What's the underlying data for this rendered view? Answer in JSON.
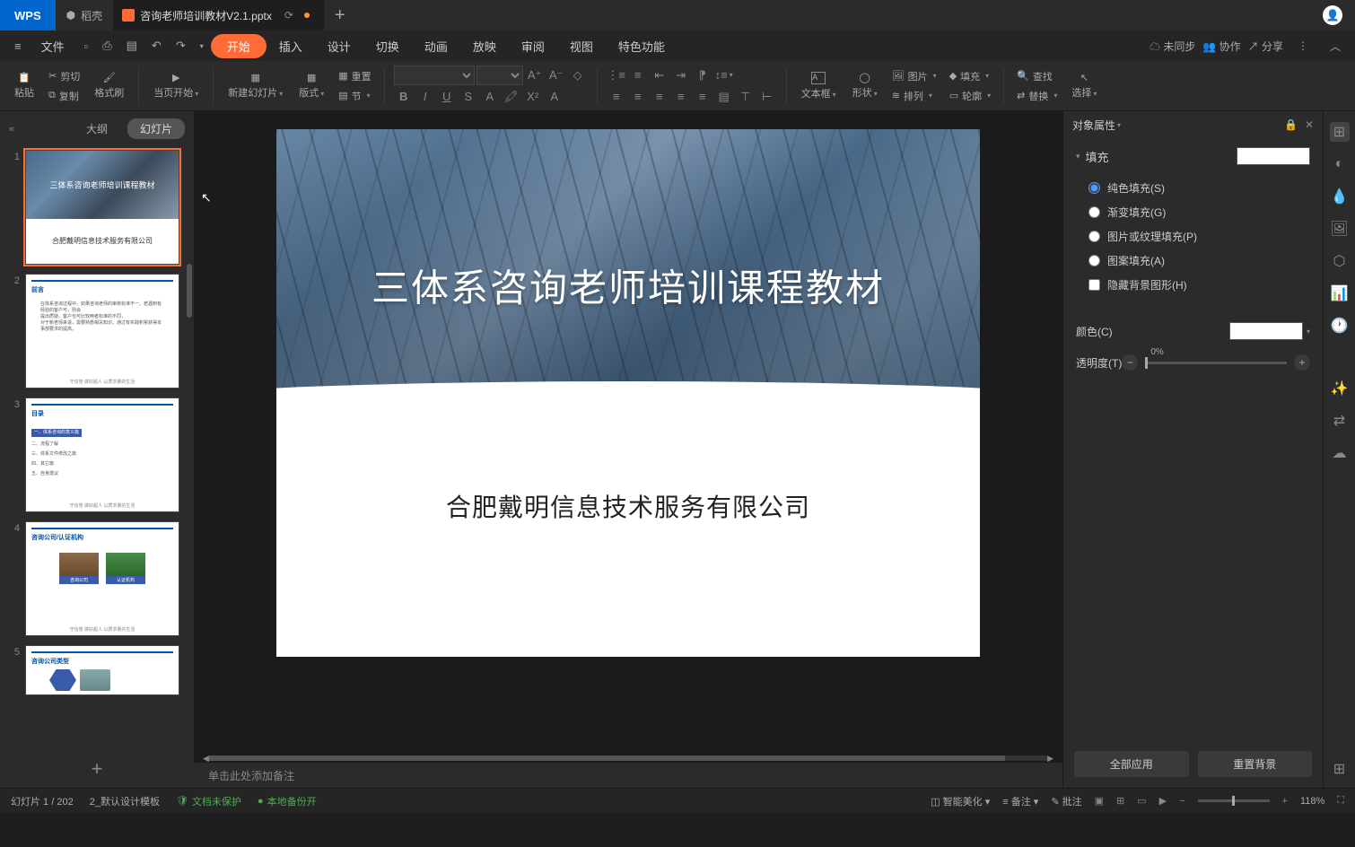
{
  "titlebar": {
    "logo": "WPS",
    "docke": "稻壳",
    "filename": "咨询老师培训教材V2.1.pptx",
    "add": "+"
  },
  "menubar": {
    "file": "文件",
    "items": [
      "开始",
      "插入",
      "设计",
      "切换",
      "动画",
      "放映",
      "审阅",
      "视图",
      "特色功能"
    ],
    "sync": "未同步",
    "collab": "协作",
    "share": "分享"
  },
  "ribbon": {
    "paste": "粘贴",
    "cut": "剪切",
    "copy": "复制",
    "format_painter": "格式刷",
    "from_current": "当页开始",
    "new_slide": "新建幻灯片",
    "layout": "版式",
    "chapter": "节",
    "reset": "重置",
    "textbox": "文本框",
    "shape": "形状",
    "picture": "图片",
    "fill": "填充",
    "arrange": "排列",
    "outline_btn": "轮廓",
    "find": "查找",
    "replace": "替换",
    "select": "选择"
  },
  "thumb_panel": {
    "outline_tab": "大纲",
    "slides_tab": "幻灯片",
    "slides": [
      {
        "title": "三体系咨询老师培训课程教材",
        "company": "合肥戴明信息技术服务有限公司"
      },
      {
        "title": "前言"
      },
      {
        "title": "目录",
        "items": [
          "一、体系咨询的意义篇",
          "二、流程了解",
          "三、体系文件修改之篇",
          "四、其它篇",
          "五、自身建议"
        ]
      },
      {
        "title": "咨询公司/认证机构",
        "box1": "咨询公司",
        "box2": "认证机构"
      },
      {
        "title": "咨询公司类型"
      }
    ]
  },
  "slide": {
    "title": "三体系咨询老师培训课程教材",
    "company": "合肥戴明信息技术服务有限公司"
  },
  "notes": {
    "placeholder": "单击此处添加备注"
  },
  "prop": {
    "header": "对象属性",
    "fill_section": "填充",
    "solid": "纯色填充(S)",
    "gradient": "渐变填充(G)",
    "texture": "图片或纹理填充(P)",
    "pattern": "图案填充(A)",
    "hide_bg": "隐藏背景图形(H)",
    "color": "颜色(C)",
    "transparency": "透明度(T)",
    "trans_val": "0%",
    "apply_all": "全部应用",
    "reset_bg": "重置背景"
  },
  "status": {
    "slide_info": "幻灯片 1 / 202",
    "template": "2_默认设计模板",
    "unprotected": "文档未保护",
    "backup": "本地备份开",
    "beautify": "智能美化",
    "notes": "备注",
    "comment": "批注",
    "zoom": "118%"
  }
}
